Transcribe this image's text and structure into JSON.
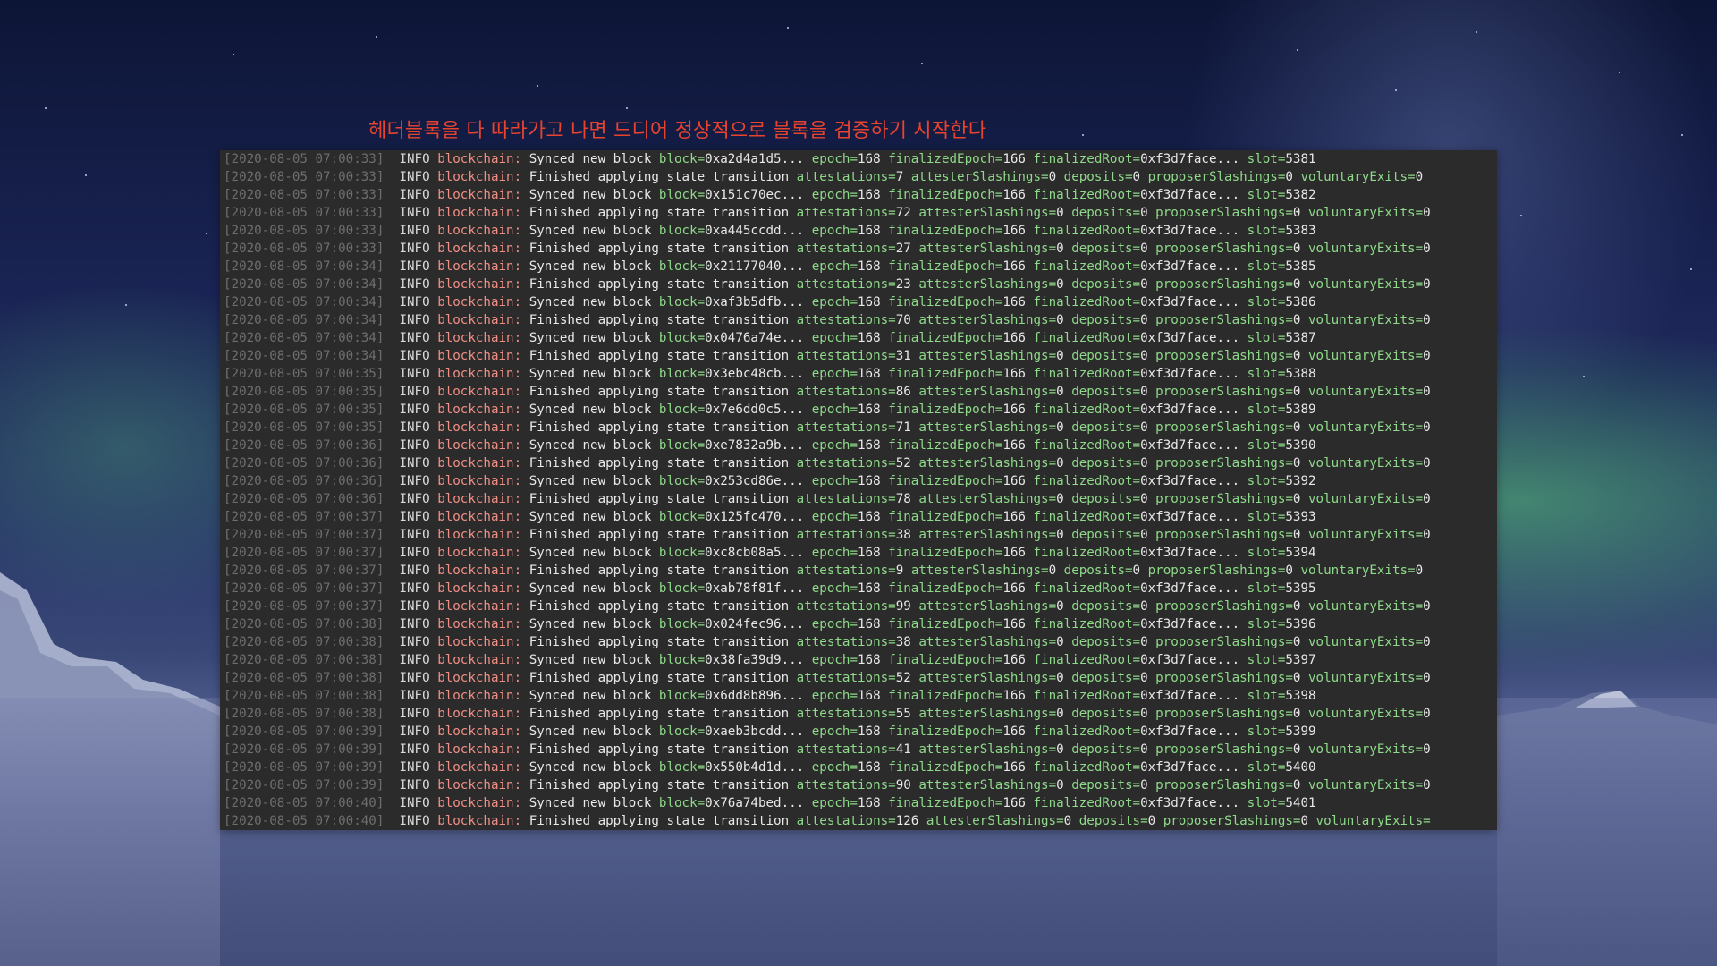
{
  "caption": "헤더블록을 다 따라가고 나면 드디어 정상적으로 블록을 검증하기 시작한다",
  "colors": {
    "caption": "#e8432f",
    "terminal_bg": "#2b2b2b",
    "timestamp": "#6e6e6e",
    "component": "#f08f85",
    "field_key": "#8fd98a",
    "text": "#e8e8e8"
  },
  "log": {
    "level": "INFO",
    "component": "blockchain:",
    "lines": [
      {
        "ts": "[2020-08-05 07:00:33]",
        "msg": "Synced new block",
        "fields": [
          [
            "block=",
            "0xa2d4a1d5..."
          ],
          [
            "epoch=",
            "168"
          ],
          [
            "finalizedEpoch=",
            "166"
          ],
          [
            "finalizedRoot=",
            "0xf3d7face..."
          ],
          [
            "slot=",
            "5381"
          ]
        ]
      },
      {
        "ts": "[2020-08-05 07:00:33]",
        "msg": "Finished applying state transition",
        "fields": [
          [
            "attestations=",
            "7"
          ],
          [
            "attesterSlashings=",
            "0"
          ],
          [
            "deposits=",
            "0"
          ],
          [
            "proposerSlashings=",
            "0"
          ],
          [
            "voluntaryExits=",
            "0"
          ]
        ]
      },
      {
        "ts": "[2020-08-05 07:00:33]",
        "msg": "Synced new block",
        "fields": [
          [
            "block=",
            "0x151c70ec..."
          ],
          [
            "epoch=",
            "168"
          ],
          [
            "finalizedEpoch=",
            "166"
          ],
          [
            "finalizedRoot=",
            "0xf3d7face..."
          ],
          [
            "slot=",
            "5382"
          ]
        ]
      },
      {
        "ts": "[2020-08-05 07:00:33]",
        "msg": "Finished applying state transition",
        "fields": [
          [
            "attestations=",
            "72"
          ],
          [
            "attesterSlashings=",
            "0"
          ],
          [
            "deposits=",
            "0"
          ],
          [
            "proposerSlashings=",
            "0"
          ],
          [
            "voluntaryExits=",
            "0"
          ]
        ]
      },
      {
        "ts": "[2020-08-05 07:00:33]",
        "msg": "Synced new block",
        "fields": [
          [
            "block=",
            "0xa445ccdd..."
          ],
          [
            "epoch=",
            "168"
          ],
          [
            "finalizedEpoch=",
            "166"
          ],
          [
            "finalizedRoot=",
            "0xf3d7face..."
          ],
          [
            "slot=",
            "5383"
          ]
        ]
      },
      {
        "ts": "[2020-08-05 07:00:33]",
        "msg": "Finished applying state transition",
        "fields": [
          [
            "attestations=",
            "27"
          ],
          [
            "attesterSlashings=",
            "0"
          ],
          [
            "deposits=",
            "0"
          ],
          [
            "proposerSlashings=",
            "0"
          ],
          [
            "voluntaryExits=",
            "0"
          ]
        ]
      },
      {
        "ts": "[2020-08-05 07:00:34]",
        "msg": "Synced new block",
        "fields": [
          [
            "block=",
            "0x21177040..."
          ],
          [
            "epoch=",
            "168"
          ],
          [
            "finalizedEpoch=",
            "166"
          ],
          [
            "finalizedRoot=",
            "0xf3d7face..."
          ],
          [
            "slot=",
            "5385"
          ]
        ]
      },
      {
        "ts": "[2020-08-05 07:00:34]",
        "msg": "Finished applying state transition",
        "fields": [
          [
            "attestations=",
            "23"
          ],
          [
            "attesterSlashings=",
            "0"
          ],
          [
            "deposits=",
            "0"
          ],
          [
            "proposerSlashings=",
            "0"
          ],
          [
            "voluntaryExits=",
            "0"
          ]
        ]
      },
      {
        "ts": "[2020-08-05 07:00:34]",
        "msg": "Synced new block",
        "fields": [
          [
            "block=",
            "0xaf3b5dfb..."
          ],
          [
            "epoch=",
            "168"
          ],
          [
            "finalizedEpoch=",
            "166"
          ],
          [
            "finalizedRoot=",
            "0xf3d7face..."
          ],
          [
            "slot=",
            "5386"
          ]
        ]
      },
      {
        "ts": "[2020-08-05 07:00:34]",
        "msg": "Finished applying state transition",
        "fields": [
          [
            "attestations=",
            "70"
          ],
          [
            "attesterSlashings=",
            "0"
          ],
          [
            "deposits=",
            "0"
          ],
          [
            "proposerSlashings=",
            "0"
          ],
          [
            "voluntaryExits=",
            "0"
          ]
        ]
      },
      {
        "ts": "[2020-08-05 07:00:34]",
        "msg": "Synced new block",
        "fields": [
          [
            "block=",
            "0x0476a74e..."
          ],
          [
            "epoch=",
            "168"
          ],
          [
            "finalizedEpoch=",
            "166"
          ],
          [
            "finalizedRoot=",
            "0xf3d7face..."
          ],
          [
            "slot=",
            "5387"
          ]
        ]
      },
      {
        "ts": "[2020-08-05 07:00:34]",
        "msg": "Finished applying state transition",
        "fields": [
          [
            "attestations=",
            "31"
          ],
          [
            "attesterSlashings=",
            "0"
          ],
          [
            "deposits=",
            "0"
          ],
          [
            "proposerSlashings=",
            "0"
          ],
          [
            "voluntaryExits=",
            "0"
          ]
        ]
      },
      {
        "ts": "[2020-08-05 07:00:35]",
        "msg": "Synced new block",
        "fields": [
          [
            "block=",
            "0x3ebc48cb..."
          ],
          [
            "epoch=",
            "168"
          ],
          [
            "finalizedEpoch=",
            "166"
          ],
          [
            "finalizedRoot=",
            "0xf3d7face..."
          ],
          [
            "slot=",
            "5388"
          ]
        ]
      },
      {
        "ts": "[2020-08-05 07:00:35]",
        "msg": "Finished applying state transition",
        "fields": [
          [
            "attestations=",
            "86"
          ],
          [
            "attesterSlashings=",
            "0"
          ],
          [
            "deposits=",
            "0"
          ],
          [
            "proposerSlashings=",
            "0"
          ],
          [
            "voluntaryExits=",
            "0"
          ]
        ]
      },
      {
        "ts": "[2020-08-05 07:00:35]",
        "msg": "Synced new block",
        "fields": [
          [
            "block=",
            "0x7e6dd0c5..."
          ],
          [
            "epoch=",
            "168"
          ],
          [
            "finalizedEpoch=",
            "166"
          ],
          [
            "finalizedRoot=",
            "0xf3d7face..."
          ],
          [
            "slot=",
            "5389"
          ]
        ]
      },
      {
        "ts": "[2020-08-05 07:00:35]",
        "msg": "Finished applying state transition",
        "fields": [
          [
            "attestations=",
            "71"
          ],
          [
            "attesterSlashings=",
            "0"
          ],
          [
            "deposits=",
            "0"
          ],
          [
            "proposerSlashings=",
            "0"
          ],
          [
            "voluntaryExits=",
            "0"
          ]
        ]
      },
      {
        "ts": "[2020-08-05 07:00:36]",
        "msg": "Synced new block",
        "fields": [
          [
            "block=",
            "0xe7832a9b..."
          ],
          [
            "epoch=",
            "168"
          ],
          [
            "finalizedEpoch=",
            "166"
          ],
          [
            "finalizedRoot=",
            "0xf3d7face..."
          ],
          [
            "slot=",
            "5390"
          ]
        ]
      },
      {
        "ts": "[2020-08-05 07:00:36]",
        "msg": "Finished applying state transition",
        "fields": [
          [
            "attestations=",
            "52"
          ],
          [
            "attesterSlashings=",
            "0"
          ],
          [
            "deposits=",
            "0"
          ],
          [
            "proposerSlashings=",
            "0"
          ],
          [
            "voluntaryExits=",
            "0"
          ]
        ]
      },
      {
        "ts": "[2020-08-05 07:00:36]",
        "msg": "Synced new block",
        "fields": [
          [
            "block=",
            "0x253cd86e..."
          ],
          [
            "epoch=",
            "168"
          ],
          [
            "finalizedEpoch=",
            "166"
          ],
          [
            "finalizedRoot=",
            "0xf3d7face..."
          ],
          [
            "slot=",
            "5392"
          ]
        ]
      },
      {
        "ts": "[2020-08-05 07:00:36]",
        "msg": "Finished applying state transition",
        "fields": [
          [
            "attestations=",
            "78"
          ],
          [
            "attesterSlashings=",
            "0"
          ],
          [
            "deposits=",
            "0"
          ],
          [
            "proposerSlashings=",
            "0"
          ],
          [
            "voluntaryExits=",
            "0"
          ]
        ]
      },
      {
        "ts": "[2020-08-05 07:00:37]",
        "msg": "Synced new block",
        "fields": [
          [
            "block=",
            "0x125fc470..."
          ],
          [
            "epoch=",
            "168"
          ],
          [
            "finalizedEpoch=",
            "166"
          ],
          [
            "finalizedRoot=",
            "0xf3d7face..."
          ],
          [
            "slot=",
            "5393"
          ]
        ]
      },
      {
        "ts": "[2020-08-05 07:00:37]",
        "msg": "Finished applying state transition",
        "fields": [
          [
            "attestations=",
            "38"
          ],
          [
            "attesterSlashings=",
            "0"
          ],
          [
            "deposits=",
            "0"
          ],
          [
            "proposerSlashings=",
            "0"
          ],
          [
            "voluntaryExits=",
            "0"
          ]
        ]
      },
      {
        "ts": "[2020-08-05 07:00:37]",
        "msg": "Synced new block",
        "fields": [
          [
            "block=",
            "0xc8cb08a5..."
          ],
          [
            "epoch=",
            "168"
          ],
          [
            "finalizedEpoch=",
            "166"
          ],
          [
            "finalizedRoot=",
            "0xf3d7face..."
          ],
          [
            "slot=",
            "5394"
          ]
        ]
      },
      {
        "ts": "[2020-08-05 07:00:37]",
        "msg": "Finished applying state transition",
        "fields": [
          [
            "attestations=",
            "9"
          ],
          [
            "attesterSlashings=",
            "0"
          ],
          [
            "deposits=",
            "0"
          ],
          [
            "proposerSlashings=",
            "0"
          ],
          [
            "voluntaryExits=",
            "0"
          ]
        ]
      },
      {
        "ts": "[2020-08-05 07:00:37]",
        "msg": "Synced new block",
        "fields": [
          [
            "block=",
            "0xab78f81f..."
          ],
          [
            "epoch=",
            "168"
          ],
          [
            "finalizedEpoch=",
            "166"
          ],
          [
            "finalizedRoot=",
            "0xf3d7face..."
          ],
          [
            "slot=",
            "5395"
          ]
        ]
      },
      {
        "ts": "[2020-08-05 07:00:37]",
        "msg": "Finished applying state transition",
        "fields": [
          [
            "attestations=",
            "99"
          ],
          [
            "attesterSlashings=",
            "0"
          ],
          [
            "deposits=",
            "0"
          ],
          [
            "proposerSlashings=",
            "0"
          ],
          [
            "voluntaryExits=",
            "0"
          ]
        ]
      },
      {
        "ts": "[2020-08-05 07:00:38]",
        "msg": "Synced new block",
        "fields": [
          [
            "block=",
            "0x024fec96..."
          ],
          [
            "epoch=",
            "168"
          ],
          [
            "finalizedEpoch=",
            "166"
          ],
          [
            "finalizedRoot=",
            "0xf3d7face..."
          ],
          [
            "slot=",
            "5396"
          ]
        ]
      },
      {
        "ts": "[2020-08-05 07:00:38]",
        "msg": "Finished applying state transition",
        "fields": [
          [
            "attestations=",
            "38"
          ],
          [
            "attesterSlashings=",
            "0"
          ],
          [
            "deposits=",
            "0"
          ],
          [
            "proposerSlashings=",
            "0"
          ],
          [
            "voluntaryExits=",
            "0"
          ]
        ]
      },
      {
        "ts": "[2020-08-05 07:00:38]",
        "msg": "Synced new block",
        "fields": [
          [
            "block=",
            "0x38fa39d9..."
          ],
          [
            "epoch=",
            "168"
          ],
          [
            "finalizedEpoch=",
            "166"
          ],
          [
            "finalizedRoot=",
            "0xf3d7face..."
          ],
          [
            "slot=",
            "5397"
          ]
        ]
      },
      {
        "ts": "[2020-08-05 07:00:38]",
        "msg": "Finished applying state transition",
        "fields": [
          [
            "attestations=",
            "52"
          ],
          [
            "attesterSlashings=",
            "0"
          ],
          [
            "deposits=",
            "0"
          ],
          [
            "proposerSlashings=",
            "0"
          ],
          [
            "voluntaryExits=",
            "0"
          ]
        ]
      },
      {
        "ts": "[2020-08-05 07:00:38]",
        "msg": "Synced new block",
        "fields": [
          [
            "block=",
            "0x6dd8b896..."
          ],
          [
            "epoch=",
            "168"
          ],
          [
            "finalizedEpoch=",
            "166"
          ],
          [
            "finalizedRoot=",
            "0xf3d7face..."
          ],
          [
            "slot=",
            "5398"
          ]
        ]
      },
      {
        "ts": "[2020-08-05 07:00:38]",
        "msg": "Finished applying state transition",
        "fields": [
          [
            "attestations=",
            "55"
          ],
          [
            "attesterSlashings=",
            "0"
          ],
          [
            "deposits=",
            "0"
          ],
          [
            "proposerSlashings=",
            "0"
          ],
          [
            "voluntaryExits=",
            "0"
          ]
        ]
      },
      {
        "ts": "[2020-08-05 07:00:39]",
        "msg": "Synced new block",
        "fields": [
          [
            "block=",
            "0xaeb3bcdd..."
          ],
          [
            "epoch=",
            "168"
          ],
          [
            "finalizedEpoch=",
            "166"
          ],
          [
            "finalizedRoot=",
            "0xf3d7face..."
          ],
          [
            "slot=",
            "5399"
          ]
        ]
      },
      {
        "ts": "[2020-08-05 07:00:39]",
        "msg": "Finished applying state transition",
        "fields": [
          [
            "attestations=",
            "41"
          ],
          [
            "attesterSlashings=",
            "0"
          ],
          [
            "deposits=",
            "0"
          ],
          [
            "proposerSlashings=",
            "0"
          ],
          [
            "voluntaryExits=",
            "0"
          ]
        ]
      },
      {
        "ts": "[2020-08-05 07:00:39]",
        "msg": "Synced new block",
        "fields": [
          [
            "block=",
            "0x550b4d1d..."
          ],
          [
            "epoch=",
            "168"
          ],
          [
            "finalizedEpoch=",
            "166"
          ],
          [
            "finalizedRoot=",
            "0xf3d7face..."
          ],
          [
            "slot=",
            "5400"
          ]
        ]
      },
      {
        "ts": "[2020-08-05 07:00:39]",
        "msg": "Finished applying state transition",
        "fields": [
          [
            "attestations=",
            "90"
          ],
          [
            "attesterSlashings=",
            "0"
          ],
          [
            "deposits=",
            "0"
          ],
          [
            "proposerSlashings=",
            "0"
          ],
          [
            "voluntaryExits=",
            "0"
          ]
        ]
      },
      {
        "ts": "[2020-08-05 07:00:40]",
        "msg": "Synced new block",
        "fields": [
          [
            "block=",
            "0x76a74bed..."
          ],
          [
            "epoch=",
            "168"
          ],
          [
            "finalizedEpoch=",
            "166"
          ],
          [
            "finalizedRoot=",
            "0xf3d7face..."
          ],
          [
            "slot=",
            "5401"
          ]
        ]
      },
      {
        "ts": "[2020-08-05 07:00:40]",
        "msg": "Finished applying state transition",
        "fields": [
          [
            "attestations=",
            "126"
          ],
          [
            "attesterSlashings=",
            "0"
          ],
          [
            "deposits=",
            "0"
          ],
          [
            "proposerSlashings=",
            "0"
          ],
          [
            "voluntaryExits=",
            ""
          ]
        ]
      }
    ]
  }
}
